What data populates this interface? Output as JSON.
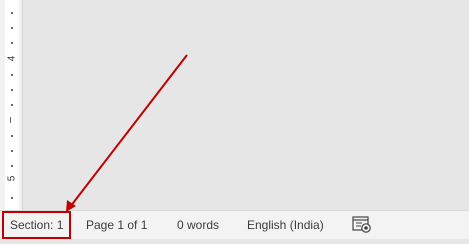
{
  "ruler": {
    "numbers": [
      "4",
      "5"
    ]
  },
  "status_bar": {
    "section": "Section: 1",
    "page": "Page 1 of 1",
    "words": "0 words",
    "language": "English (India)",
    "focus_icon": "focus-mode-icon"
  },
  "annotation": {
    "arrow_color": "#c00000",
    "highlight_color": "#c00000"
  }
}
